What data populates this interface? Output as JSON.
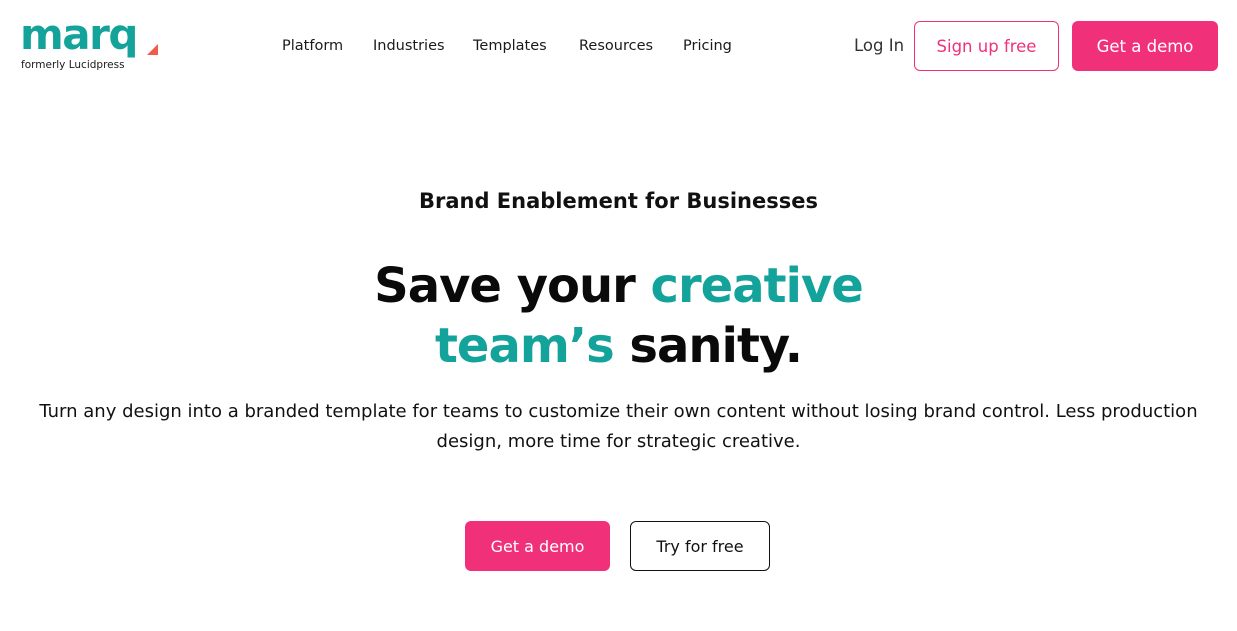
{
  "brand": {
    "logo_text": "marq",
    "tagline": "formerly Lucidpress",
    "colors": {
      "teal": "#13a39a",
      "pink": "#f0317a",
      "coral": "#ef5c4a"
    }
  },
  "nav": {
    "items": [
      "Platform",
      "Industries",
      "Templates",
      "Resources",
      "Pricing"
    ]
  },
  "header_actions": {
    "login": "Log In",
    "signup": "Sign up free",
    "demo": "Get a demo"
  },
  "hero": {
    "eyebrow": "Brand Enablement for Businesses",
    "headline": {
      "part1": "Save your ",
      "accent1": "creative",
      "accent2": "team’s",
      "part2": " sanity."
    },
    "lead": "Turn any design into a branded template for teams to customize their own content without losing brand control. Less production design, more time for strategic creative.",
    "cta_primary": "Get a demo",
    "cta_secondary": "Try for free"
  }
}
